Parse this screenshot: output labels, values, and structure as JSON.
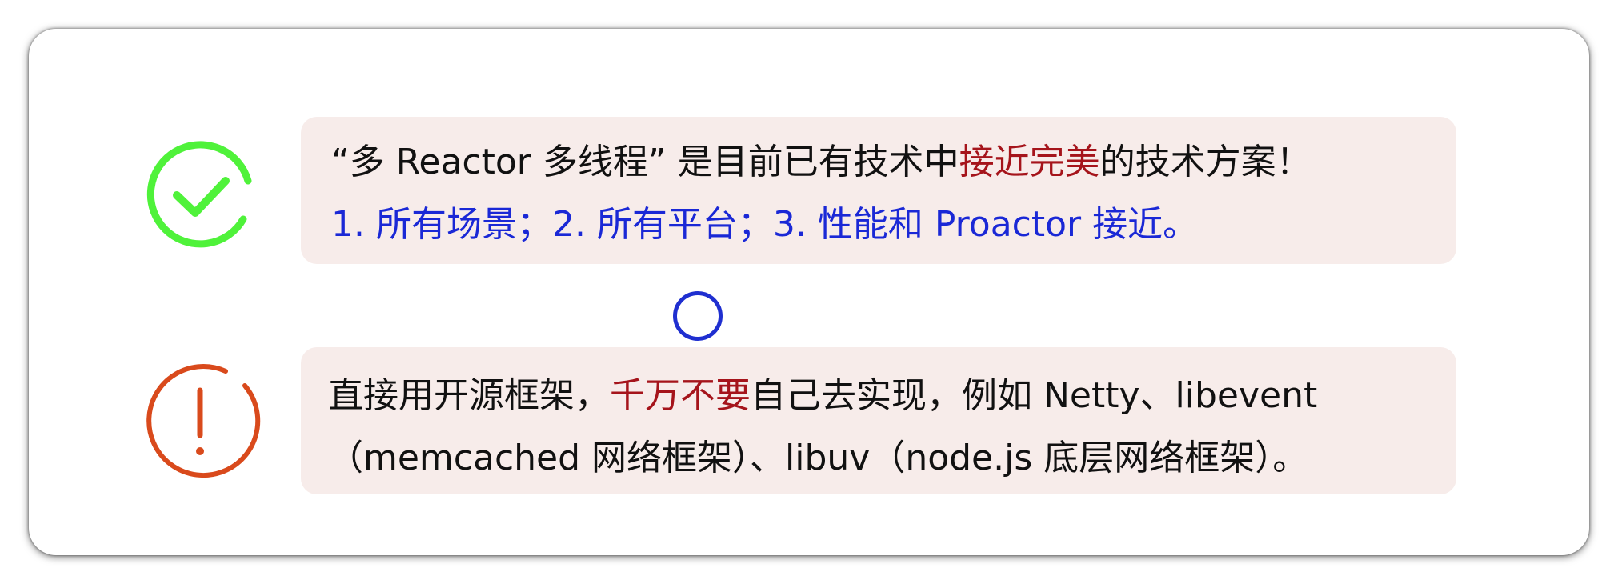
{
  "items": [
    {
      "icon": "check-circle-icon",
      "icon_color": "#4ff23a",
      "line1": {
        "before": "“多 Reactor 多线程” 是目前已有技术中",
        "highlight": "接近完美",
        "after": "的技术方案！"
      },
      "line2": "1. 所有场景；2. 所有平台；3. 性能和 Proactor 接近。"
    },
    {
      "icon": "exclamation-circle-icon",
      "icon_color": "#d94a1c",
      "line1": {
        "before": "直接用开源框架，",
        "highlight": "千万不要",
        "after": "自己去实现，例如 Netty、libevent"
      },
      "line2": "（memcached 网络框架）、libuv（node.js 底层网络框架）。"
    }
  ],
  "colors": {
    "highlight_red": "#a5141b",
    "text_blue": "#1a28d6",
    "box_background": "#f7ecea",
    "cursor_blue": "#1f2fd0"
  }
}
